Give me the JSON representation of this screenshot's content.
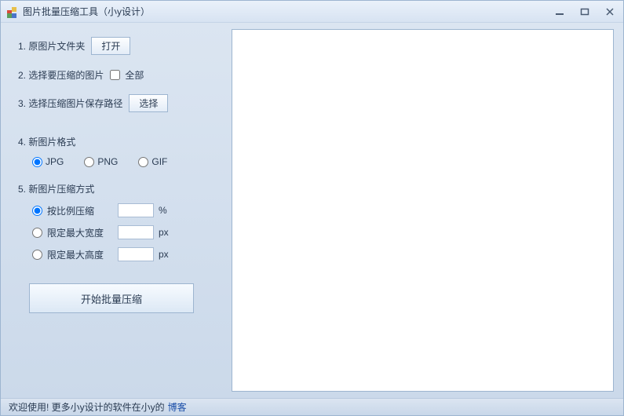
{
  "window": {
    "title": "图片批量压缩工具（小y设计）"
  },
  "left": {
    "step1_label": "1. 原图片文件夹",
    "step1_button": "打开",
    "step2_label": "2. 选择要压缩的图片",
    "step2_checkbox": "全部",
    "step3_label": "3. 选择压缩图片保存路径",
    "step3_button": "选择",
    "step4_label": "4. 新图片格式",
    "format_jpg": "JPG",
    "format_png": "PNG",
    "format_gif": "GIF",
    "step5_label": "5. 新图片压缩方式",
    "mode_ratio": "按比例压缩",
    "mode_ratio_unit": "%",
    "mode_ratio_value": "",
    "mode_maxw": "限定最大宽度",
    "mode_maxw_unit": "px",
    "mode_maxw_value": "",
    "mode_maxh": "限定最大高度",
    "mode_maxh_unit": "px",
    "mode_maxh_value": "",
    "start_button": "开始批量压缩"
  },
  "status": {
    "text": "欢迎使用! 更多小y设计的软件在小y的",
    "link": "博客"
  }
}
